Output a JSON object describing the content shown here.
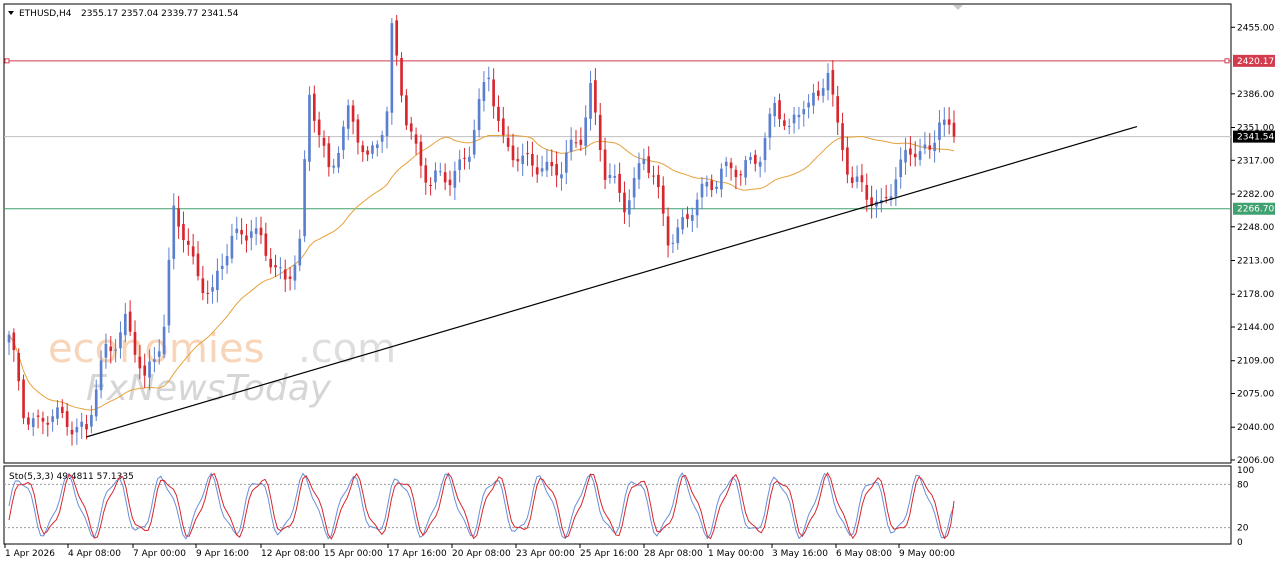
{
  "chart_data": {
    "type": "candlestick",
    "symbol_label": "ETHUSD,H4",
    "ohlc_label": "2355.17 2357.04 2339.77 2341.54",
    "ylim": [
      2006,
      2475
    ],
    "y_ticks": [
      "2455.00",
      "2420.17",
      "2386.00",
      "2351.00",
      "2341.54",
      "2317.00",
      "2282.00",
      "2266.70",
      "2248.00",
      "2213.00",
      "2178.00",
      "2144.00",
      "2109.00",
      "2075.00",
      "2040.00",
      "2006.00"
    ],
    "x_ticks": [
      "1 Apr 2026",
      "4 Apr 08:00",
      "7 Apr 00:00",
      "9 Apr 16:00",
      "12 Apr 08:00",
      "15 Apr 00:00",
      "17 Apr 16:00",
      "20 Apr 08:00",
      "23 Apr 00:00",
      "25 Apr 16:00",
      "28 Apr 08:00",
      "1 May 00:00",
      "3 May 16:00",
      "6 May 08:00",
      "9 May 00:00"
    ],
    "last_price": 2341.54,
    "resistance": 2420.17,
    "support": 2266.7,
    "resistance_label": "2420.17",
    "support_label": "2266.70",
    "last_price_label": "2341.54",
    "colors": {
      "bull": "#5b7fcf",
      "bear": "#d7262d",
      "ma": "#e6a23c",
      "resistance": "#d23c4c",
      "support": "#3fa16f",
      "trend": "#000000"
    },
    "anchors": [
      {
        "i": 0,
        "p": 2130
      },
      {
        "i": 3,
        "p": 2060
      },
      {
        "i": 6,
        "p": 2045
      },
      {
        "i": 12,
        "p": 2050
      },
      {
        "i": 16,
        "p": 2035
      },
      {
        "i": 20,
        "p": 2120
      },
      {
        "i": 24,
        "p": 2150
      },
      {
        "i": 28,
        "p": 2085
      },
      {
        "i": 32,
        "p": 2150
      },
      {
        "i": 34,
        "p": 2262
      },
      {
        "i": 38,
        "p": 2210
      },
      {
        "i": 42,
        "p": 2178
      },
      {
        "i": 46,
        "p": 2235
      },
      {
        "i": 50,
        "p": 2252
      },
      {
        "i": 53,
        "p": 2215
      },
      {
        "i": 57,
        "p": 2195
      },
      {
        "i": 60,
        "p": 2230
      },
      {
        "i": 62,
        "p": 2380
      },
      {
        "i": 66,
        "p": 2310
      },
      {
        "i": 70,
        "p": 2360
      },
      {
        "i": 74,
        "p": 2320
      },
      {
        "i": 78,
        "p": 2365
      },
      {
        "i": 79,
        "p": 2445
      },
      {
        "i": 82,
        "p": 2360
      },
      {
        "i": 87,
        "p": 2290
      },
      {
        "i": 91,
        "p": 2300
      },
      {
        "i": 95,
        "p": 2330
      },
      {
        "i": 99,
        "p": 2405
      },
      {
        "i": 102,
        "p": 2340
      },
      {
        "i": 106,
        "p": 2310
      },
      {
        "i": 110,
        "p": 2315
      },
      {
        "i": 114,
        "p": 2305
      },
      {
        "i": 118,
        "p": 2345
      },
      {
        "i": 120,
        "p": 2395
      },
      {
        "i": 123,
        "p": 2300
      },
      {
        "i": 127,
        "p": 2275
      },
      {
        "i": 131,
        "p": 2320
      },
      {
        "i": 133,
        "p": 2295
      },
      {
        "i": 136,
        "p": 2240
      },
      {
        "i": 140,
        "p": 2255
      },
      {
        "i": 144,
        "p": 2290
      },
      {
        "i": 147,
        "p": 2310
      },
      {
        "i": 151,
        "p": 2300
      },
      {
        "i": 155,
        "p": 2330
      },
      {
        "i": 158,
        "p": 2370
      },
      {
        "i": 161,
        "p": 2345
      },
      {
        "i": 164,
        "p": 2385
      },
      {
        "i": 167,
        "p": 2375
      },
      {
        "i": 169,
        "p": 2410
      },
      {
        "i": 171,
        "p": 2350
      },
      {
        "i": 174,
        "p": 2300
      },
      {
        "i": 177,
        "p": 2275
      },
      {
        "i": 180,
        "p": 2270
      },
      {
        "i": 183,
        "p": 2305
      },
      {
        "i": 187,
        "p": 2325
      },
      {
        "i": 190,
        "p": 2330
      },
      {
        "i": 192,
        "p": 2365
      },
      {
        "i": 194,
        "p": 2340
      }
    ],
    "stochastic": {
      "label": "Sto(5,3,3) 49.4811 57.1335",
      "main": 49.4811,
      "signal": 57.1335,
      "levels": [
        80,
        20
      ],
      "scale_labels": [
        "100",
        "80",
        "20",
        "0"
      ]
    }
  },
  "watermark": {
    "line1_a": "economies",
    "line1_b": ".com",
    "line2": "FxNewsToday"
  }
}
